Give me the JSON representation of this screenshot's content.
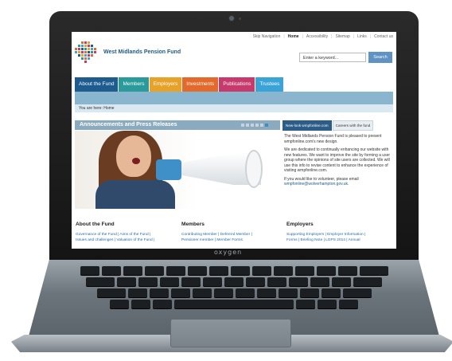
{
  "device": {
    "brand": "oxygen"
  },
  "site": {
    "top_links": [
      "Skip Navigation",
      "Home",
      "Accessibility",
      "Sitemap",
      "Links",
      "Contact us"
    ],
    "logo_text": "West Midlands Pension Fund",
    "search": {
      "placeholder": "Enter a keyword...",
      "button": "Search"
    },
    "tabs": [
      {
        "label": "About the Fund",
        "color": "#1e5b8f"
      },
      {
        "label": "Members",
        "color": "#2a9a9a"
      },
      {
        "label": "Employers",
        "color": "#e8a22a"
      },
      {
        "label": "Investments",
        "color": "#e46a2c"
      },
      {
        "label": "Publications",
        "color": "#c93a6c"
      },
      {
        "label": "Trustees",
        "color": "#3aa3d8"
      }
    ],
    "breadcrumb": "You are here:  Home",
    "announcements": {
      "title": "Announcements and Press Releases"
    },
    "side_tabs": [
      "New-look wmpfonline.com",
      "Careers with the fund"
    ],
    "side_paragraphs": [
      "The West Midlands Pension Fund is pleased to present wmpfonline.com's new design.",
      "We are dedicated to continually enhancing our website with new features. We want to improve the site by forming a user group where the opinions of site users are collected. We will use this info to revise content to enhance the experience of visiting wmpfonline.com.",
      "If you would like to volunteer, please email"
    ],
    "side_email": "wmpfonline@wolverhampton.gov.uk.",
    "columns": [
      {
        "title": "About the Fund",
        "lines": [
          "Governance of the Fund  |  Aims of the Fund  |",
          "Issues and challenges  |  Valuation of the Fund  |"
        ]
      },
      {
        "title": "Members",
        "lines": [
          "Contributing Member  |  Deferred Member  |",
          "Pensioner member  |  Member Forms"
        ]
      },
      {
        "title": "Employers",
        "lines": [
          "Supporting Employers  |  Employer Information  |",
          "Forms  |  Briefing Note  |  LGPS 2014  |  Annual"
        ]
      }
    ]
  }
}
